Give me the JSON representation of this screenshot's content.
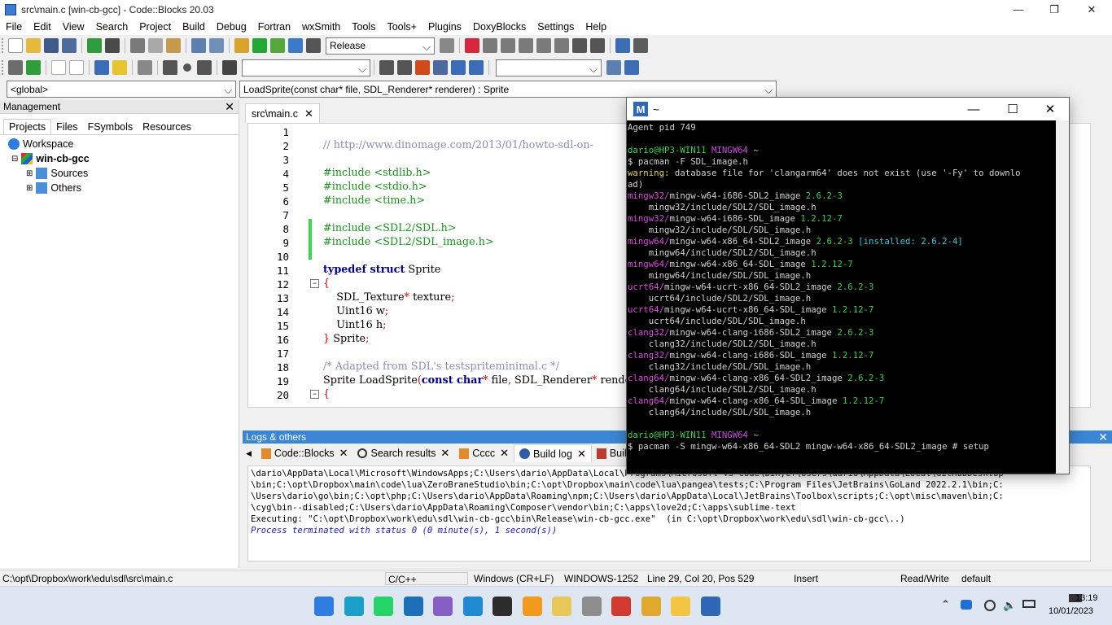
{
  "window": {
    "title": "src\\main.c [win-cb-gcc] - Code::Blocks 20.03"
  },
  "menu": [
    "File",
    "Edit",
    "View",
    "Search",
    "Project",
    "Build",
    "Debug",
    "Fortran",
    "wxSmith",
    "Tools",
    "Tools+",
    "Plugins",
    "DoxyBlocks",
    "Settings",
    "Help"
  ],
  "toolbar": {
    "build_target": "Release"
  },
  "scope": {
    "global": "<global>",
    "function": "LoadSprite(const char* file, SDL_Renderer* renderer) : Sprite"
  },
  "management": {
    "title": "Management",
    "tabs": [
      "Projects",
      "Files",
      "FSymbols",
      "Resources"
    ],
    "tree": {
      "workspace": "Workspace",
      "project": "win-cb-gcc",
      "sources": "Sources",
      "others": "Others"
    }
  },
  "editor": {
    "tab": "src\\main.c",
    "lines": [
      {
        "n": "1",
        "segs": [
          {
            "t": "",
            "c": "#000"
          }
        ]
      },
      {
        "n": "2",
        "segs": [
          {
            "t": "// http://www.dinomage.com/2013/01/howto-sdl-on-",
            "c": "#8a8fb3"
          }
        ]
      },
      {
        "n": "3",
        "segs": [
          {
            "t": "",
            "c": "#000"
          }
        ]
      },
      {
        "n": "4",
        "segs": [
          {
            "t": "#include <stdlib.h>",
            "c": "#1f8f1f"
          }
        ]
      },
      {
        "n": "5",
        "segs": [
          {
            "t": "#include <stdio.h>",
            "c": "#1f8f1f"
          }
        ]
      },
      {
        "n": "6",
        "segs": [
          {
            "t": "#include <time.h>",
            "c": "#1f8f1f"
          }
        ]
      },
      {
        "n": "7",
        "segs": [
          {
            "t": "",
            "c": "#000"
          }
        ]
      },
      {
        "n": "8",
        "segs": [
          {
            "t": "#include <SDL2/SDL.h>",
            "c": "#1f8f1f"
          }
        ]
      },
      {
        "n": "9",
        "segs": [
          {
            "t": "#include <SDL2/SDL_image.h>",
            "c": "#1f8f1f"
          }
        ]
      },
      {
        "n": "10",
        "segs": [
          {
            "t": "",
            "c": "#000"
          }
        ]
      },
      {
        "n": "11",
        "segs": [
          {
            "t": "typedef struct",
            "c": "#00008b",
            "b": true
          },
          {
            "t": " Sprite",
            "c": "#000"
          }
        ]
      },
      {
        "n": "12",
        "segs": [
          {
            "t": "{",
            "c": "#d00000"
          }
        ]
      },
      {
        "n": "13",
        "segs": [
          {
            "t": "    SDL_Texture",
            "c": "#000"
          },
          {
            "t": "*",
            "c": "#d00000"
          },
          {
            "t": " texture",
            "c": "#000"
          },
          {
            "t": ";",
            "c": "#d00000"
          }
        ]
      },
      {
        "n": "14",
        "segs": [
          {
            "t": "    Uint16 w",
            "c": "#000"
          },
          {
            "t": ";",
            "c": "#d00000"
          }
        ]
      },
      {
        "n": "15",
        "segs": [
          {
            "t": "    Uint16 h",
            "c": "#000"
          },
          {
            "t": ";",
            "c": "#d00000"
          }
        ]
      },
      {
        "n": "16",
        "segs": [
          {
            "t": "}",
            "c": "#d00000"
          },
          {
            "t": " Sprite",
            "c": "#000"
          },
          {
            "t": ";",
            "c": "#d00000"
          }
        ]
      },
      {
        "n": "17",
        "segs": [
          {
            "t": "",
            "c": "#000"
          }
        ]
      },
      {
        "n": "18",
        "segs": [
          {
            "t": "/* Adapted from SDL's testspriteminimal.c */",
            "c": "#8a8fb3"
          }
        ]
      },
      {
        "n": "19",
        "segs": [
          {
            "t": "Sprite LoadSprite",
            "c": "#000"
          },
          {
            "t": "(",
            "c": "#d00000"
          },
          {
            "t": "const char",
            "c": "#00008b",
            "b": true
          },
          {
            "t": "*",
            "c": "#d00000"
          },
          {
            "t": " file",
            "c": "#000"
          },
          {
            "t": ",",
            "c": "#d00000"
          },
          {
            "t": " SDL_Renderer",
            "c": "#000"
          },
          {
            "t": "*",
            "c": "#d00000"
          },
          {
            "t": " renderer",
            "c": "#000"
          },
          {
            "t": ")",
            "c": "#d00000"
          }
        ]
      },
      {
        "n": "20",
        "segs": [
          {
            "t": "{",
            "c": "#d00000"
          }
        ]
      }
    ]
  },
  "logs": {
    "title": "Logs & others",
    "tabs": [
      "Code::Blocks",
      "Search results",
      "Cccc",
      "Build log",
      "Build messages"
    ],
    "lines": [
      {
        "t": "\\dario\\AppData\\Local\\Microsoft\\WindowsApps;C:\\Users\\dario\\AppData\\Local\\Programs\\Microsoft VS Code\\bin;C:\\Users\\dario\\AppData\\Local\\GitHubDesktop",
        "c": "#000",
        "i": false
      },
      {
        "t": "\\bin;C:\\opt\\Dropbox\\main\\code\\lua\\ZeroBraneStudio\\bin;C:\\opt\\Dropbox\\main\\code\\lua\\pangea\\tests;C:\\Program Files\\JetBrains\\GoLand 2022.2.1\\bin;C:",
        "c": "#000",
        "i": false
      },
      {
        "t": "\\Users\\dario\\go\\bin;C:\\opt\\php;C:\\Users\\dario\\AppData\\Roaming\\npm;C:\\Users\\dario\\AppData\\Local\\JetBrains\\Toolbox\\scripts;C:\\opt\\misc\\maven\\bin;C:",
        "c": "#000",
        "i": false
      },
      {
        "t": "\\cyg\\bin--disabled;C:\\Users\\dario\\AppData\\Roaming\\Composer\\vendor\\bin;C:\\apps\\love2d;C:\\apps\\sublime-text",
        "c": "#000",
        "i": false
      },
      {
        "t": "Executing: \"C:\\opt\\Dropbox\\work\\edu\\sdl\\win-cb-gcc\\bin\\Release\\win-cb-gcc.exe\"  (in C:\\opt\\Dropbox\\work\\edu\\sdl\\win-cb-gcc\\..)",
        "c": "#000",
        "i": false
      },
      {
        "t": "Process terminated with status 0 (0 minute(s), 1 second(s))",
        "c": "#1a1acc",
        "i": true
      }
    ]
  },
  "status": {
    "path": "C:\\opt\\Dropbox\\work\\edu\\sdl\\src\\main.c",
    "lang": "C/C++",
    "eol": "Windows (CR+LF)",
    "encoding": "WINDOWS-1252",
    "position": "Line 29, Col 20, Pos 529",
    "mode": "Insert",
    "access": "Read/Write",
    "profile": "default"
  },
  "terminal": {
    "title": "~",
    "lines": [
      [
        {
          "t": "Agent pid 749",
          "c": "#d0d0d0"
        }
      ],
      [
        {
          "t": "",
          "c": "#d0d0d0"
        }
      ],
      [
        {
          "t": "dario@HP3-WIN11 ",
          "c": "#3ecf4f"
        },
        {
          "t": "MINGW64 ",
          "c": "#c84fd8"
        },
        {
          "t": "~",
          "c": "#d4c340"
        }
      ],
      [
        {
          "t": "$ pacman -F SDL_image.h",
          "c": "#d0d0d0"
        }
      ],
      [
        {
          "t": "warning:",
          "c": "#e3d35a"
        },
        {
          "t": " database file for 'clangarm64' does not exist (use '-Fy' to downlo",
          "c": "#d0d0d0"
        }
      ],
      [
        {
          "t": "ad)",
          "c": "#d0d0d0"
        }
      ],
      [
        {
          "t": "mingw32/",
          "c": "#d64fd8"
        },
        {
          "t": "mingw-w64-i686-SDL2_image ",
          "c": "#d0d0d0"
        },
        {
          "t": "2.6.2-3",
          "c": "#3ecf4f"
        }
      ],
      [
        {
          "t": "    mingw32/include/SDL2/SDL_image.h",
          "c": "#d0d0d0"
        }
      ],
      [
        {
          "t": "mingw32/",
          "c": "#d64fd8"
        },
        {
          "t": "mingw-w64-i686-SDL_image ",
          "c": "#d0d0d0"
        },
        {
          "t": "1.2.12-7",
          "c": "#3ecf4f"
        }
      ],
      [
        {
          "t": "    mingw32/include/SDL/SDL_image.h",
          "c": "#d0d0d0"
        }
      ],
      [
        {
          "t": "mingw64/",
          "c": "#d64fd8"
        },
        {
          "t": "mingw-w64-x86_64-SDL2_image ",
          "c": "#d0d0d0"
        },
        {
          "t": "2.6.2-3 ",
          "c": "#3ecf4f"
        },
        {
          "t": "[installed: 2.6.2-4]",
          "c": "#3cc4d6"
        }
      ],
      [
        {
          "t": "    mingw64/include/SDL2/SDL_image.h",
          "c": "#d0d0d0"
        }
      ],
      [
        {
          "t": "mingw64/",
          "c": "#d64fd8"
        },
        {
          "t": "mingw-w64-x86_64-SDL_image ",
          "c": "#d0d0d0"
        },
        {
          "t": "1.2.12-7",
          "c": "#3ecf4f"
        }
      ],
      [
        {
          "t": "    mingw64/include/SDL/SDL_image.h",
          "c": "#d0d0d0"
        }
      ],
      [
        {
          "t": "ucrt64/",
          "c": "#d64fd8"
        },
        {
          "t": "mingw-w64-ucrt-x86_64-SDL2_image ",
          "c": "#d0d0d0"
        },
        {
          "t": "2.6.2-3",
          "c": "#3ecf4f"
        }
      ],
      [
        {
          "t": "    ucrt64/include/SDL2/SDL_image.h",
          "c": "#d0d0d0"
        }
      ],
      [
        {
          "t": "ucrt64/",
          "c": "#d64fd8"
        },
        {
          "t": "mingw-w64-ucrt-x86_64-SDL_image ",
          "c": "#d0d0d0"
        },
        {
          "t": "1.2.12-7",
          "c": "#3ecf4f"
        }
      ],
      [
        {
          "t": "    ucrt64/include/SDL/SDL_image.h",
          "c": "#d0d0d0"
        }
      ],
      [
        {
          "t": "clang32/",
          "c": "#d64fd8"
        },
        {
          "t": "mingw-w64-clang-i686-SDL2_image ",
          "c": "#d0d0d0"
        },
        {
          "t": "2.6.2-3",
          "c": "#3ecf4f"
        }
      ],
      [
        {
          "t": "    clang32/include/SDL2/SDL_image.h",
          "c": "#d0d0d0"
        }
      ],
      [
        {
          "t": "clang32/",
          "c": "#d64fd8"
        },
        {
          "t": "mingw-w64-clang-i686-SDL_image ",
          "c": "#d0d0d0"
        },
        {
          "t": "1.2.12-7",
          "c": "#3ecf4f"
        }
      ],
      [
        {
          "t": "    clang32/include/SDL/SDL_image.h",
          "c": "#d0d0d0"
        }
      ],
      [
        {
          "t": "clang64/",
          "c": "#d64fd8"
        },
        {
          "t": "mingw-w64-clang-x86_64-SDL2_image ",
          "c": "#d0d0d0"
        },
        {
          "t": "2.6.2-3",
          "c": "#3ecf4f"
        }
      ],
      [
        {
          "t": "    clang64/include/SDL2/SDL_image.h",
          "c": "#d0d0d0"
        }
      ],
      [
        {
          "t": "clang64/",
          "c": "#d64fd8"
        },
        {
          "t": "mingw-w64-clang-x86_64-SDL_image ",
          "c": "#d0d0d0"
        },
        {
          "t": "1.2.12-7",
          "c": "#3ecf4f"
        }
      ],
      [
        {
          "t": "    clang64/include/SDL/SDL_image.h",
          "c": "#d0d0d0"
        }
      ],
      [
        {
          "t": "",
          "c": "#d0d0d0"
        }
      ],
      [
        {
          "t": "dario@HP3-WIN11 ",
          "c": "#3ecf4f"
        },
        {
          "t": "MINGW64 ",
          "c": "#c84fd8"
        },
        {
          "t": "~",
          "c": "#d4c340"
        }
      ],
      [
        {
          "t": "$ pacman -S mingw-w64-x86_64-SDL2 mingw-w64-x86_64-SDL2_image # setup",
          "c": "#d0d0d0"
        }
      ]
    ]
  },
  "taskbar": {
    "time": "13:19",
    "date": "10/01/2023",
    "apps": [
      {
        "name": "start-icon",
        "color": "#2f7de1"
      },
      {
        "name": "edge-icon",
        "color": "#1ba1c9"
      },
      {
        "name": "whatsapp-icon",
        "color": "#25d366"
      },
      {
        "name": "app-blue-icon",
        "color": "#1d6fb8"
      },
      {
        "name": "visual-studio-icon",
        "color": "#865fc5"
      },
      {
        "name": "vscode-icon",
        "color": "#1f8ad2"
      },
      {
        "name": "terminal-icon",
        "color": "#2c2c2c"
      },
      {
        "name": "sublime-text-icon",
        "color": "#f29a1e"
      },
      {
        "name": "app-yellow-icon",
        "color": "#e8c85a"
      },
      {
        "name": "app-grey-icon",
        "color": "#8d8d8d"
      },
      {
        "name": "codeblocks-icon",
        "color": "#d23a2f"
      },
      {
        "name": "chrome-icon",
        "color": "#e0a82e"
      },
      {
        "name": "file-explorer-icon",
        "color": "#f4c543"
      },
      {
        "name": "msys2-icon",
        "color": "#2e67b5"
      }
    ]
  }
}
